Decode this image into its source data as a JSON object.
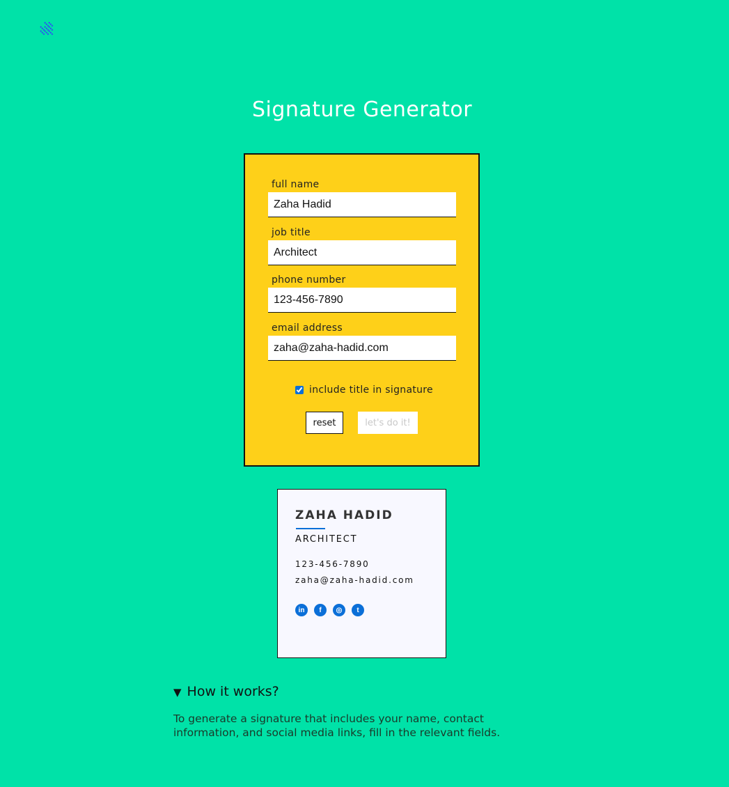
{
  "logo": {
    "icon": "diagonal-stripes-logo-icon",
    "color": "#2f4cf5"
  },
  "header": {
    "title": "Signature Generator"
  },
  "form": {
    "fields": [
      {
        "label": "full name",
        "value": "Zaha Hadid"
      },
      {
        "label": "job title",
        "value": "Architect"
      },
      {
        "label": "phone number",
        "value": "123-456-7890"
      },
      {
        "label": "email address",
        "value": "zaha@zaha-hadid.com"
      }
    ],
    "checkbox_label": "include title in signature",
    "checkbox_checked": true,
    "reset_label": "reset",
    "submit_label": "let's do it!"
  },
  "signature": {
    "name": "ZAHA HADID",
    "title": "ARCHITECT",
    "phone": "123-456-7890",
    "email": "zaha@zaha-hadid.com",
    "socials": [
      "linkedin-icon",
      "facebook-icon",
      "instagram-icon",
      "twitter-icon"
    ],
    "social_glyphs": [
      "in",
      "f",
      "◎",
      "t"
    ]
  },
  "how_it_works": {
    "summary": "How it works?",
    "text": "To generate a signature that includes your name, contact information, and social media links, fill in the relevant fields."
  },
  "colors": {
    "background": "#00e2a8",
    "form": "#fed019",
    "accent": "#0b6fd8"
  }
}
